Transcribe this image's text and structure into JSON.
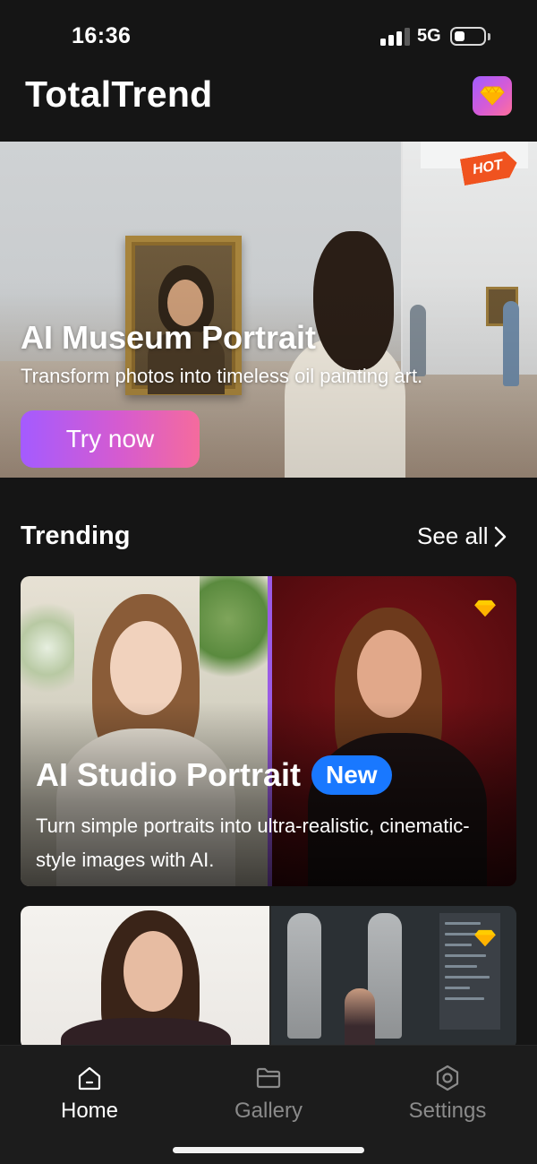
{
  "status_bar": {
    "time": "16:36",
    "network": "5G"
  },
  "header": {
    "title": "TotalTrend",
    "premium_icon": "diamond-icon"
  },
  "hero": {
    "badge": "HOT",
    "title": "AI Museum Portrait",
    "subtitle": "Transform photos into timeless oil painting art.",
    "cta_label": "Try now"
  },
  "trending": {
    "title": "Trending",
    "see_all_label": "See all",
    "cards": [
      {
        "title": "AI Studio Portrait",
        "badge": "New",
        "description": "Turn simple portraits into ultra-realistic, cinematic-style images with AI.",
        "premium_icon": "diamond-icon"
      },
      {
        "premium_icon": "diamond-icon"
      }
    ]
  },
  "tab_bar": {
    "items": [
      {
        "label": "Home",
        "icon": "home-icon",
        "active": true
      },
      {
        "label": "Gallery",
        "icon": "folder-icon",
        "active": false
      },
      {
        "label": "Settings",
        "icon": "gear-hexagon-icon",
        "active": false
      }
    ]
  },
  "colors": {
    "background": "#151515",
    "accent_gradient_start": "#a45bff",
    "accent_gradient_end": "#f56b9d",
    "new_badge": "#1978ff",
    "hot_badge": "#f0531f",
    "premium_gem": "#ffc400"
  }
}
